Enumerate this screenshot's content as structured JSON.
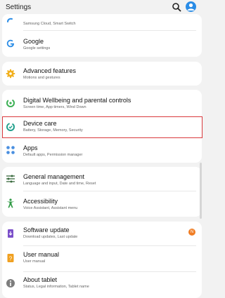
{
  "header": {
    "title": "Settings"
  },
  "items": [
    {
      "title": "",
      "subtitle": "Samsung Cloud, Smart Switch"
    },
    {
      "title": "Google",
      "subtitle": "Google settings"
    },
    {
      "title": "Advanced features",
      "subtitle": "Motions and gestures"
    },
    {
      "title": "Digital Wellbeing and parental controls",
      "subtitle": "Screen time, App timers, Wind Down"
    },
    {
      "title": "Device care",
      "subtitle": "Battery, Storage, Memory, Security"
    },
    {
      "title": "Apps",
      "subtitle": "Default apps, Permission manager"
    },
    {
      "title": "General management",
      "subtitle": "Language and input, Date and time, Reset"
    },
    {
      "title": "Accessibility",
      "subtitle": "Voice Assistant, Assistant menu"
    },
    {
      "title": "Software update",
      "subtitle": "Download updates, Last update"
    },
    {
      "title": "User manual",
      "subtitle": "User manual"
    },
    {
      "title": "About tablet",
      "subtitle": "Status, Legal information, Tablet name"
    }
  ],
  "badge": "N",
  "colors": {
    "accent_blue": "#2a8ce6",
    "highlight_red": "#d9393d",
    "badge_orange": "#f07d24"
  }
}
